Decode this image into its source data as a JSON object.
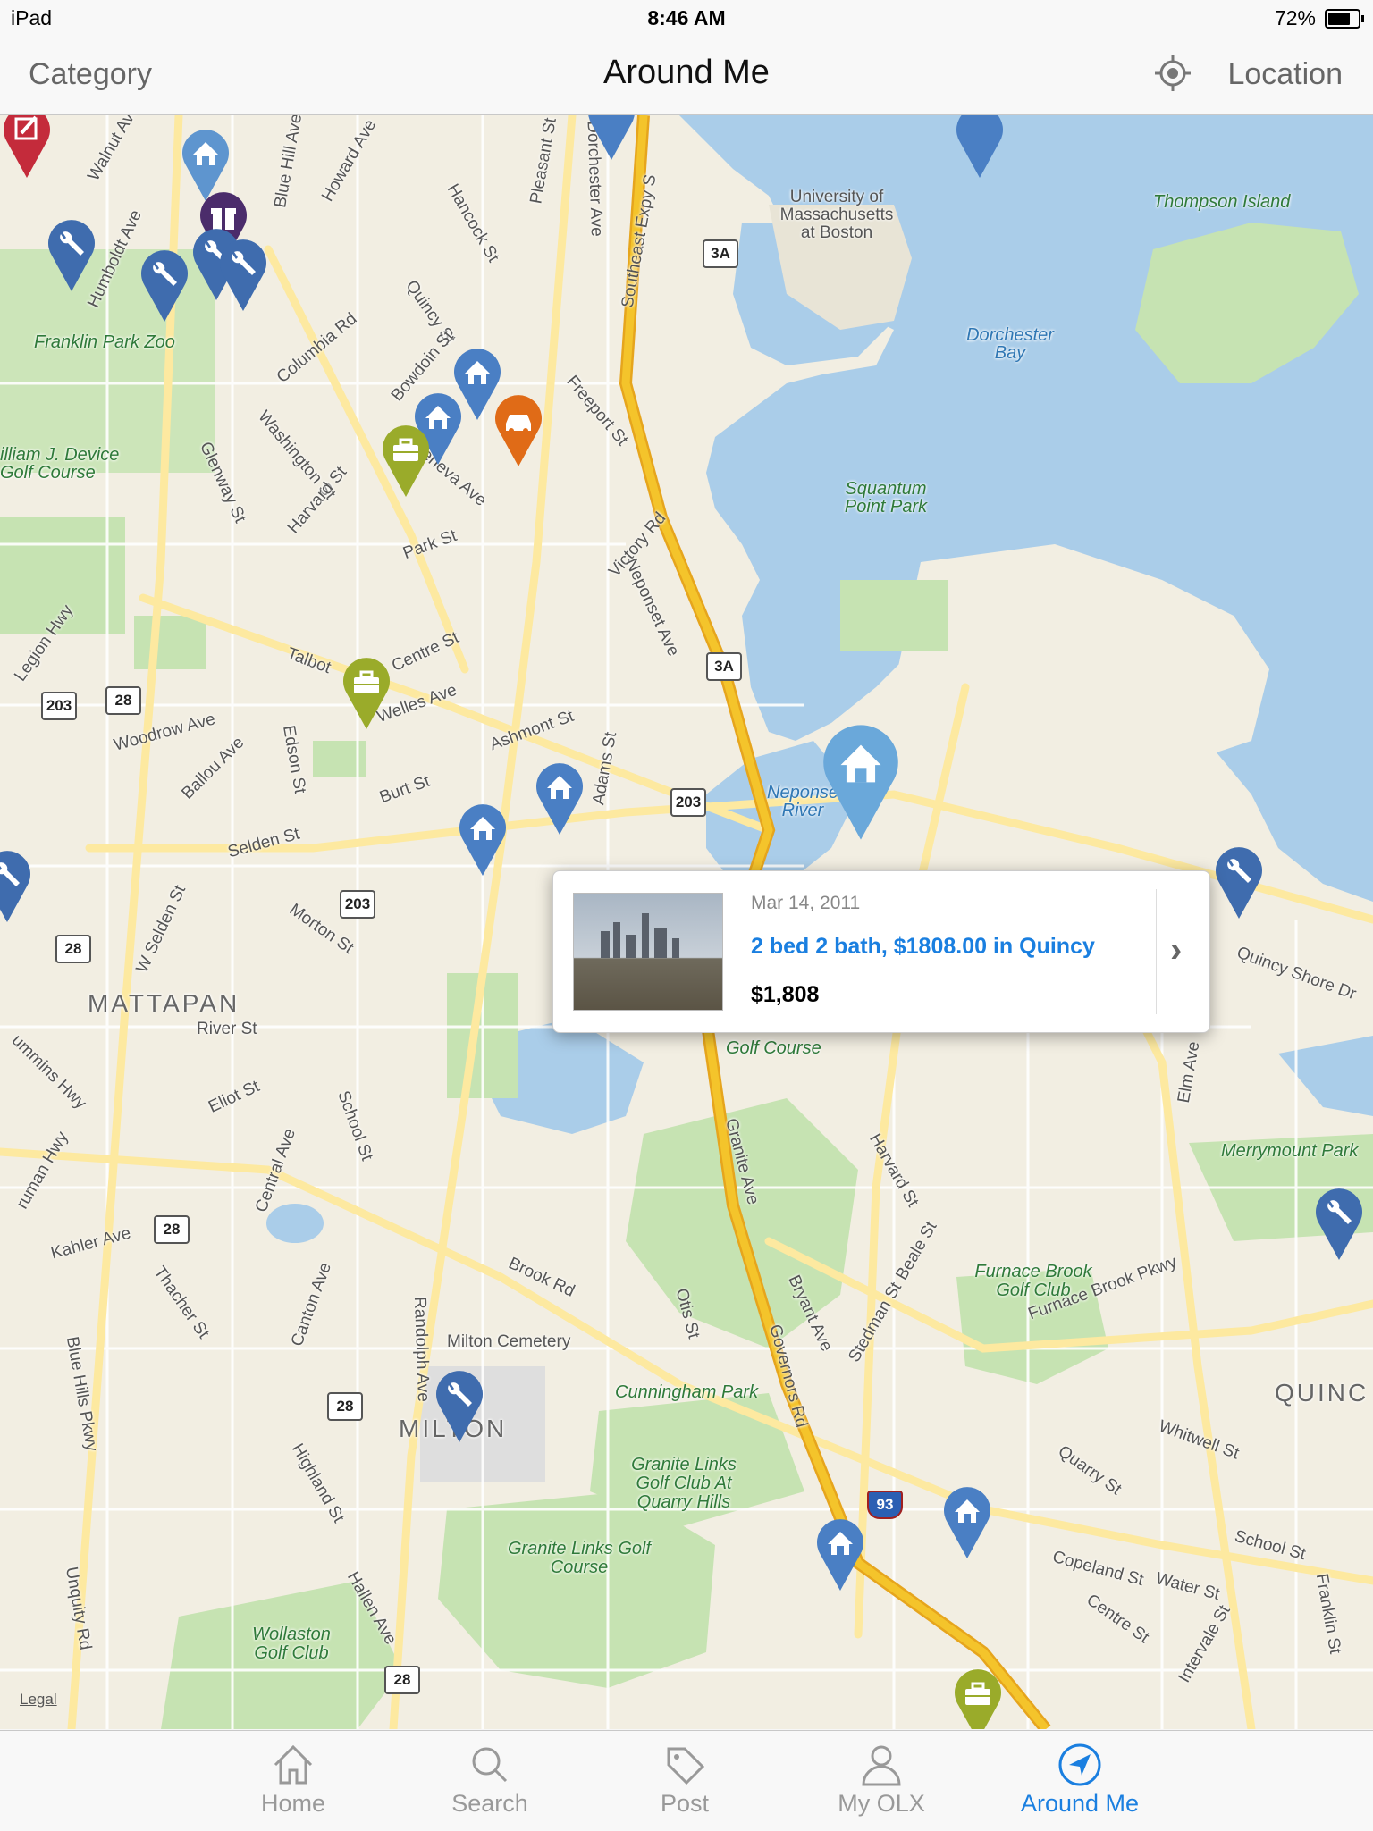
{
  "status_bar": {
    "carrier": "iPad",
    "time": "8:46 AM",
    "battery": "72%"
  },
  "nav": {
    "left": "Category",
    "title": "Around Me",
    "right": "Location"
  },
  "map": {
    "labels": {
      "umass": "University of Massachusetts at Boston",
      "thompson": "Thompson Island",
      "dorchester_bay": "Dorchester Bay",
      "squantum": "Squantum Point Park",
      "franklin_zoo": "Franklin Park Zoo",
      "devine": "illiam J. Device Golf Course",
      "mattapan": "MATTAPAN",
      "milton_cem": "Milton Cemetery",
      "cunningham": "Cunningham Park",
      "granite_links": "Granite Links Golf Club At Quarry Hills",
      "granite_links_course": "Granite Links Golf Course",
      "wollaston": "Wollaston Golf Club",
      "furnace": "Furnace Brook Golf Club",
      "merrymount": "Merrymount Park",
      "quincy": "QUINC",
      "milton": "MILTON",
      "neponset": "Neponset River",
      "golf_course": "Golf Course",
      "walnut": "Walnut Ave",
      "humboldt": "Humboldt Ave",
      "bluehill": "Blue Hill Ave",
      "howard": "Howard Ave",
      "hancock": "Hancock St",
      "pleasant": "Pleasant St",
      "dorchester_ave": "Dorchester Ave",
      "se_expy": "Southeast Expy S",
      "columbia": "Columbia Rd",
      "quincy_st": "Quincy St",
      "bowdoin": "Bowdoin St",
      "freeport": "Freeport St",
      "washington": "Washington St",
      "glenway": "Glenway St",
      "harvard": "Harvard St",
      "geneva": "Geneva Ave",
      "park": "Park St",
      "victory": "Victory Rd",
      "neponset_ave": "Neponset Ave",
      "talbot": "Talbot",
      "centre": "Centre St",
      "welles": "Welles Ave",
      "woodrow": "Woodrow Ave",
      "ballou": "Ballou Ave",
      "edson": "Edson St",
      "ashmont": "Ashmont St",
      "adams": "Adams St",
      "burt": "Burt St",
      "selden": "Selden St",
      "morton": "Morton St",
      "w_selden": "W Selden St",
      "river": "River St",
      "eliot": "Eliot St",
      "school": "School St",
      "central": "Central Ave",
      "kahler": "Kahler Ave",
      "thacher": "Thacher St",
      "canton": "Canton Ave",
      "brook": "Brook Rd",
      "randolph": "Randolph Ave",
      "otis": "Otis St",
      "governors": "Governors Rd",
      "bryant": "Bryant Ave",
      "granite_ave": "Granite Ave",
      "harvard2": "Harvard St",
      "beale": "Beale St",
      "stedman": "Stedman St",
      "furnace_pkwy": "Furnace Brook Pkwy",
      "whitwell": "Whitwell St",
      "quarry": "Quarry St",
      "school2": "School St",
      "copeland": "Copeland St",
      "water": "Water St",
      "centre2": "Centre St",
      "intervale": "Intervale St",
      "franklin": "Franklin St",
      "quincy_shore": "Quincy Shore Dr",
      "elm": "Elm Ave",
      "blue_hills_pkwy": "Blue Hills Pkwy",
      "unquity": "Unquity Rd",
      "highland": "Highland St",
      "hallen": "Hallen Ave",
      "legion": "Legion Hwy",
      "cummins": "ummins Hwy",
      "truman": "ruman Hwy",
      "legal": "Legal"
    },
    "shields": {
      "r3a_a": "3A",
      "r3a_b": "3A",
      "r203_a": "203",
      "r28_a": "28",
      "r203_b": "203",
      "r203_c": "203",
      "r28_b": "28",
      "r28_c": "28",
      "r28_d": "28",
      "r28_e": "28",
      "i93": "93"
    },
    "colors": {
      "water": "#aacde9",
      "park": "#c6e3b2",
      "land": "#f2eee2",
      "highway": "#f4c42b",
      "road": "#fde9a0",
      "pin_blue": "#4a7fc4",
      "pin_olive": "#9aab2a",
      "pin_orange": "#e06b17",
      "pin_red": "#c42b3b",
      "pin_purple": "#4b2c6b"
    }
  },
  "popup": {
    "date": "Mar 14, 2011",
    "title": "2 bed 2 bath, $1808.00 in Quincy",
    "price": "$1,808"
  },
  "tabs": [
    {
      "label": "Home",
      "icon": "home-icon"
    },
    {
      "label": "Search",
      "icon": "search-icon"
    },
    {
      "label": "Post",
      "icon": "tag-icon"
    },
    {
      "label": "My OLX",
      "icon": "person-icon"
    },
    {
      "label": "Around Me",
      "icon": "location-arrow-icon"
    }
  ]
}
